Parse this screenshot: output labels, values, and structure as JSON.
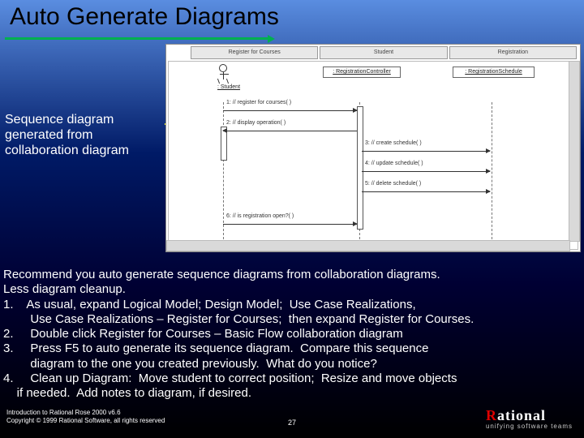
{
  "title": "Auto Generate Diagrams",
  "caption": "Sequence diagram generated from collaboration diagram",
  "diagram": {
    "tabs": [
      "Register for Courses",
      "Student",
      "Registration"
    ],
    "actor": ": Student",
    "objects": [
      {
        "label": ": RegistrationController"
      },
      {
        "label": ": RegistrationSchedule"
      }
    ],
    "messages": [
      "1: // register for courses( )",
      "2: // display operation( )",
      "3: // create schedule( )",
      "4: // update schedule( )",
      "5: // delete schedule( )",
      "6: // is registration open?( )"
    ]
  },
  "body": "Recommend you auto generate sequence diagrams from collaboration diagrams.\nLess diagram cleanup.\n1.    As usual, expand Logical Model; Design Model;  Use Case Realizations,\n        Use Case Realizations – Register for Courses;  then expand Register for Courses.\n2.     Double click Register for Courses – Basic Flow collaboration diagram\n3.     Press F5 to auto generate its sequence diagram.  Compare this sequence\n        diagram to the one you created previously.  What do you notice?\n4.     Clean up Diagram:  Move student to correct position;  Resize and move objects\n    if needed.  Add notes to diagram, if desired.",
  "footer": {
    "line1": "Introduction to Rational Rose 2000 v6.6",
    "line2": "Copyright © 1999 Rational Software, all rights reserved",
    "page": "27"
  },
  "logo": {
    "main_pre": "R",
    "main_rest": "ational",
    "sub": "unifying software teams"
  }
}
